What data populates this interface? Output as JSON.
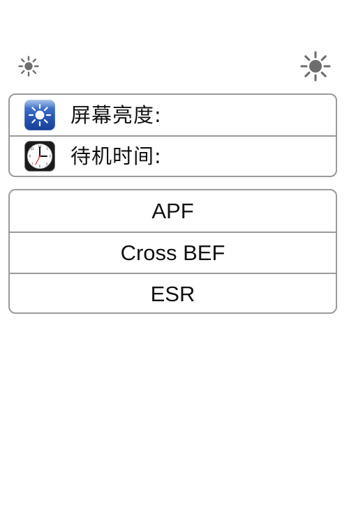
{
  "brightness_scale": {
    "min_icon": "small-sun-icon",
    "max_icon": "large-sun-icon"
  },
  "settings": [
    {
      "icon": "brightness-sun-icon",
      "label": "屏幕亮度:"
    },
    {
      "icon": "clock-icon",
      "label": "待机时间:"
    }
  ],
  "options": [
    {
      "label": "APF"
    },
    {
      "label": "Cross BEF"
    },
    {
      "label": "ESR"
    }
  ],
  "colors": {
    "border": "#9a9a9a",
    "sun": "#6d6d6d",
    "brightness_icon": "#2c5bb7",
    "clock_face": "#ffffff",
    "clock_hand_red": "#d12b2b"
  }
}
